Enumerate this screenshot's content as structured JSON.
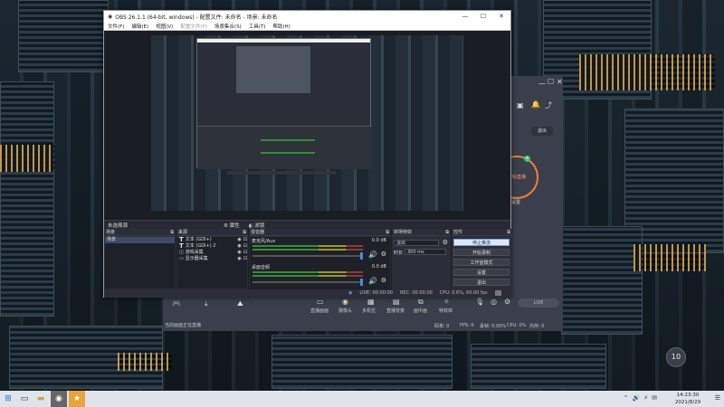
{
  "obs": {
    "title": "OBS 26.1.1 (64-bit, windows) - 配置文件: 未命名 - 场景: 未命名",
    "menu": [
      "文件(F)",
      "编辑(E)",
      "视图(V)",
      "配置文件(P)",
      "场景集合(S)",
      "工具(T)",
      "帮助(H)"
    ],
    "scene_info": {
      "none_selected": "未选择源",
      "properties": "属性",
      "filters": "滤镜"
    },
    "scenes": {
      "header": "场景",
      "items": [
        "场景"
      ]
    },
    "sources": {
      "header": "来源",
      "items": [
        "文本 (GDI+)",
        "文本 (GDI+) 2",
        "游戏采集",
        "显示器采集"
      ]
    },
    "mixer": {
      "header": "混音器",
      "tracks": [
        {
          "name": "麦克风/Aux",
          "level": "0.0 dB"
        },
        {
          "name": "桌面音频",
          "level": "0.0 dB"
        }
      ]
    },
    "transitions": {
      "header": "转场特效",
      "type": "淡出",
      "duration_label": "时长",
      "duration": "300 ms"
    },
    "controls": {
      "header": "控件",
      "buttons": [
        "停止推流",
        "开始录制",
        "工作室模式",
        "设置",
        "退出"
      ]
    },
    "status": {
      "live": "LIVE: 00:00:00",
      "rec": "REC: 00:00:00",
      "cpu": "CPU: 0.6%, 60.00 fps"
    }
  },
  "right_app": {
    "exit_label": "退出",
    "start_label": "开始直播",
    "settings_label": "设置",
    "count_label": "10",
    "tools": [
      "直播画面",
      "摄像头",
      "多机位",
      "直播背景",
      "画中画",
      "特效库"
    ],
    "bottom_left": "当前画面正在直播",
    "stats": [
      "码率: 0",
      "FPS: 0",
      "丢帧: 0.00%",
      "CPU: 0%",
      "内存: 0"
    ],
    "badge": "LIVE"
  },
  "taskbar": {
    "time": "14:23:30",
    "date": "2021/8/29"
  }
}
